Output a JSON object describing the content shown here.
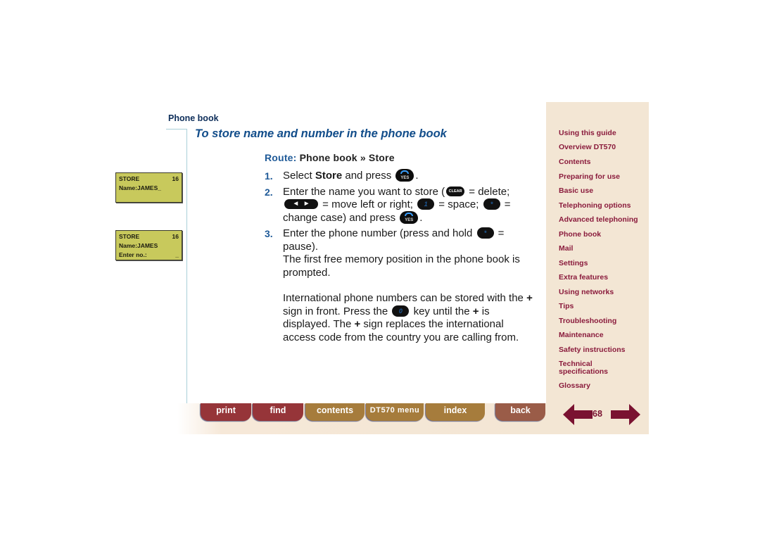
{
  "header": {
    "section": "Phone book",
    "title": "To store name and number in the phone book"
  },
  "route": {
    "label": "Route:",
    "path": "Phone book » Store"
  },
  "displays": [
    {
      "rows": [
        [
          "STORE",
          "16"
        ],
        [
          "Name:JAMES_",
          ""
        ]
      ]
    },
    {
      "rows": [
        [
          "STORE",
          "16"
        ],
        [
          "Name:JAMES",
          ""
        ],
        [
          "Enter no.:",
          "_"
        ]
      ]
    }
  ],
  "steps": [
    {
      "num": "1.",
      "parts": {
        "a": "Select ",
        "b": "Store",
        "c": " and press ",
        "d": "."
      }
    },
    {
      "num": "2.",
      "parts": {
        "a": "Enter the name you want to store (",
        "b": " = delete;",
        "c": " = move left or right; ",
        "d": " = space; ",
        "e": " = change case) and press ",
        "f": "."
      }
    },
    {
      "num": "3.",
      "parts": {
        "a": "Enter the phone number (press and hold ",
        "b": " = pause).",
        "c": "The first free memory position in the phone book is prompted."
      }
    }
  ],
  "note": {
    "a": "International phone numbers can be stored with the ",
    "plus1": "+",
    "b": " sign in front. Press the ",
    "c": " key until the ",
    "plus2": "+",
    "d": " is displayed. The ",
    "plus3": "+",
    "e": " sign replaces the international access code from the country you are calling from."
  },
  "keys": {
    "yes": "YES",
    "clear": "CLEAR",
    "one": "1",
    "star": "*",
    "zero": "0",
    "nav_left": "◀",
    "nav_right": "▶"
  },
  "sidebar": {
    "items": [
      "Using this guide",
      "Overview DT570",
      "Contents",
      "Preparing for use",
      "Basic use",
      "Telephoning options",
      "Advanced telephoning",
      "Phone book",
      "Mail",
      "Settings",
      "Extra features",
      "Using networks",
      "Tips",
      "Troubleshooting",
      "Maintenance",
      "Safety instructions",
      "Technical specifications",
      "Glossary"
    ]
  },
  "footer": {
    "buttons": [
      "print",
      "find",
      "contents",
      "DT570 menu",
      "index",
      "back"
    ],
    "page_number": "68"
  },
  "colors": {
    "title": "#124d8a",
    "nav_link": "#8a1b3c",
    "sidebar_bg": "#f3e6d4",
    "lcd_bg": "#c8c95c",
    "button_red": "#963539",
    "button_gold": "#a67c3c",
    "button_brown": "#9a5c48",
    "arrow": "#7a1231"
  }
}
